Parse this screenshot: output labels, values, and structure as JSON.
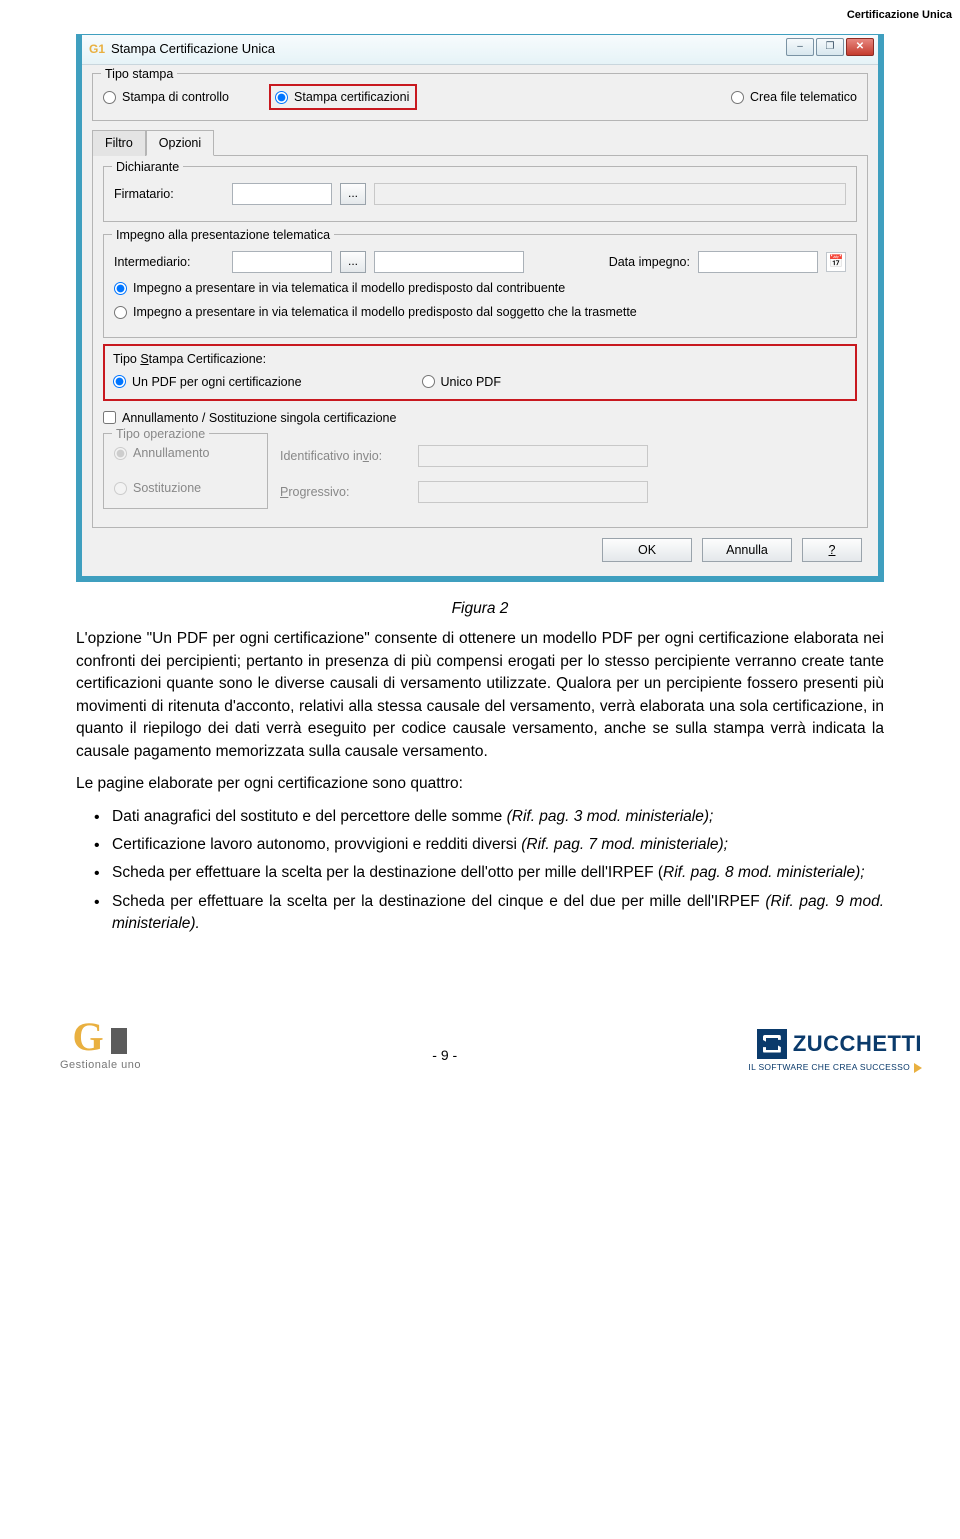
{
  "header": {
    "doc_title": "Certificazione Unica"
  },
  "window": {
    "title": "Stampa Certificazione Unica",
    "icon_text": "G1",
    "controls": {
      "min": "–",
      "max": "❐",
      "close": "✕"
    },
    "tipo_stampa": {
      "legend": "Tipo stampa",
      "opt_controllo": "Stampa di controllo",
      "opt_certificazioni": "Stampa certificazioni",
      "opt_telematico": "Crea file telematico"
    },
    "tabs": {
      "filtro": "Filtro",
      "opzioni": "Opzioni"
    },
    "dichiarante": {
      "legend": "Dichiarante",
      "firmatario_label": "Firmatario:",
      "ellipsis": "..."
    },
    "impegno": {
      "legend": "Impegno alla presentazione telematica",
      "intermediario_label": "Intermediario:",
      "ellipsis": "...",
      "data_label": "Data impegno:",
      "opt_contribuente": "Impegno a presentare in via telematica il modello predisposto dal contribuente",
      "opt_soggetto": "Impegno a presentare in via telematica il modello predisposto dal soggetto che la trasmette"
    },
    "tipo_stampa_cert": {
      "label_pre": "Tipo ",
      "label_u": "S",
      "label_post": "tampa Certificazione:",
      "opt_un_pdf": "Un PDF per ogni certificazione",
      "opt_unico": "Unico PDF"
    },
    "annullamento": {
      "chk": "Annullamento / Sostituzione singola certificazione",
      "tipo_op_legend": "Tipo operazione",
      "opt_annullamento": "Annullamento",
      "opt_sostituzione": "Sostituzione",
      "id_invio_pre": "Identificativo in",
      "id_invio_u": "v",
      "id_invio_post": "io:",
      "progr_u": "P",
      "progr_post": "rogressivo:"
    },
    "buttons": {
      "ok": "OK",
      "annulla": "Annulla",
      "help_u": "?"
    }
  },
  "figure_caption": "Figura 2",
  "para1": "L'opzione \"Un PDF per ogni certificazione\" consente di ottenere un modello PDF per ogni certificazione elaborata nei confronti dei percipienti; pertanto in presenza di più compensi erogati per lo stesso percipiente verranno create tante certificazioni quante sono le diverse causali di versamento utilizzate. Qualora per un percipiente fossero presenti più movimenti di ritenuta d'acconto, relativi alla stessa causale del versamento, verrà elaborata una sola certificazione, in quanto il riepilogo dei dati verrà eseguito per codice causale versamento, anche se sulla stampa verrà indicata la causale pagamento memorizzata sulla causale versamento.",
  "para2": "Le pagine elaborate per ogni certificazione sono quattro:",
  "bullets": [
    {
      "text": "Dati anagrafici del sostituto e del percettore delle somme ",
      "ital": "(Rif. pag. 3 mod. ministeriale);"
    },
    {
      "text": "Certificazione lavoro autonomo, provvigioni e redditi diversi ",
      "ital": "(Rif. pag. 7 mod. ministeriale);"
    },
    {
      "text": "Scheda per effettuare la scelta per la destinazione dell'otto per mille dell'IRPEF (",
      "ital": "Rif. pag. 8 mod. ministeriale);"
    },
    {
      "text": "Scheda per effettuare la scelta per la destinazione del cinque e del due per mille dell'IRPEF ",
      "ital": "(Rif. pag. 9 mod. ministeriale)."
    }
  ],
  "footer": {
    "g1_sub": "Gestionale uno",
    "page_no": "- 9 -",
    "z_name": "ZUCCHETTI",
    "z_tag": "IL SOFTWARE CHE CREA SUCCESSO"
  }
}
